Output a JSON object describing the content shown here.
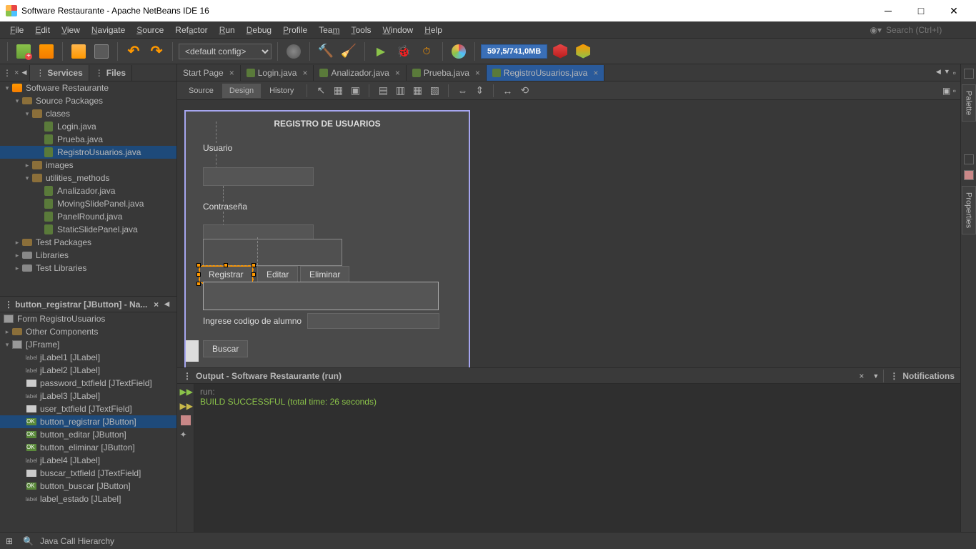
{
  "window": {
    "title": "Software Restaurante - Apache NetBeans IDE 16"
  },
  "menu": [
    "File",
    "Edit",
    "View",
    "Navigate",
    "Source",
    "Refactor",
    "Run",
    "Debug",
    "Profile",
    "Team",
    "Tools",
    "Window",
    "Help"
  ],
  "search_placeholder": "Search (Ctrl+I)",
  "toolbar": {
    "config": "<default config>",
    "memory": "597,5/741,0MB"
  },
  "left_tabs": {
    "services": "Services",
    "files": "Files"
  },
  "project_tree": {
    "root": "Software Restaurante",
    "source_packages": "Source Packages",
    "pkg_clases": "clases",
    "f_login": "Login.java",
    "f_prueba": "Prueba.java",
    "f_registro": "RegistroUsuarios.java",
    "pkg_images": "images",
    "pkg_util": "utilities_methods",
    "f_anal": "Analizador.java",
    "f_moving": "MovingSlidePanel.java",
    "f_panelr": "PanelRound.java",
    "f_static": "StaticSlidePanel.java",
    "test_pkg": "Test Packages",
    "libs": "Libraries",
    "test_libs": "Test Libraries"
  },
  "navigator": {
    "title": "button_registrar [JButton] - Na...",
    "form": "Form RegistroUsuarios",
    "other": "Other Components",
    "frame": "[JFrame]",
    "items": [
      {
        "icon": "label",
        "t": "jLabel1 [JLabel]"
      },
      {
        "icon": "label",
        "t": "jLabel2 [JLabel]"
      },
      {
        "icon": "comp",
        "t": "password_txtfield [JTextField]"
      },
      {
        "icon": "label",
        "t": "jLabel3 [JLabel]"
      },
      {
        "icon": "comp",
        "t": "user_txtfield [JTextField]"
      },
      {
        "icon": "ok",
        "t": "button_registrar [JButton]",
        "sel": true
      },
      {
        "icon": "ok",
        "t": "button_editar [JButton]"
      },
      {
        "icon": "ok",
        "t": "button_eliminar [JButton]"
      },
      {
        "icon": "label",
        "t": "jLabel4 [JLabel]"
      },
      {
        "icon": "comp",
        "t": "buscar_txtfield [JTextField]"
      },
      {
        "icon": "ok",
        "t": "button_buscar [JButton]"
      },
      {
        "icon": "label",
        "t": "label_estado [JLabel]"
      }
    ]
  },
  "editor_tabs": [
    {
      "t": "Start Page",
      "icon": false
    },
    {
      "t": "Login.java",
      "icon": true
    },
    {
      "t": "Analizador.java",
      "icon": true
    },
    {
      "t": "Prueba.java",
      "icon": true
    },
    {
      "t": "RegistroUsuarios.java",
      "icon": true,
      "active": true
    }
  ],
  "editor_toolbar": {
    "source": "Source",
    "design": "Design",
    "history": "History"
  },
  "form": {
    "title": "REGISTRO DE USUARIOS",
    "usuario": "Usuario",
    "contrasena": "Contraseña",
    "registrar": "Registrar",
    "editar": "Editar",
    "eliminar": "Eliminar",
    "ingrese": "Ingrese codigo de alumno",
    "buscar": "Buscar"
  },
  "output": {
    "tab": "Output - Software Restaurante (run)",
    "notif": "Notifications",
    "line1": "run:",
    "line2": "BUILD SUCCESSFUL (total time: 26 seconds)"
  },
  "side": {
    "palette": "Palette",
    "properties": "Properties"
  },
  "status": {
    "hierarchy": "Java Call Hierarchy"
  }
}
